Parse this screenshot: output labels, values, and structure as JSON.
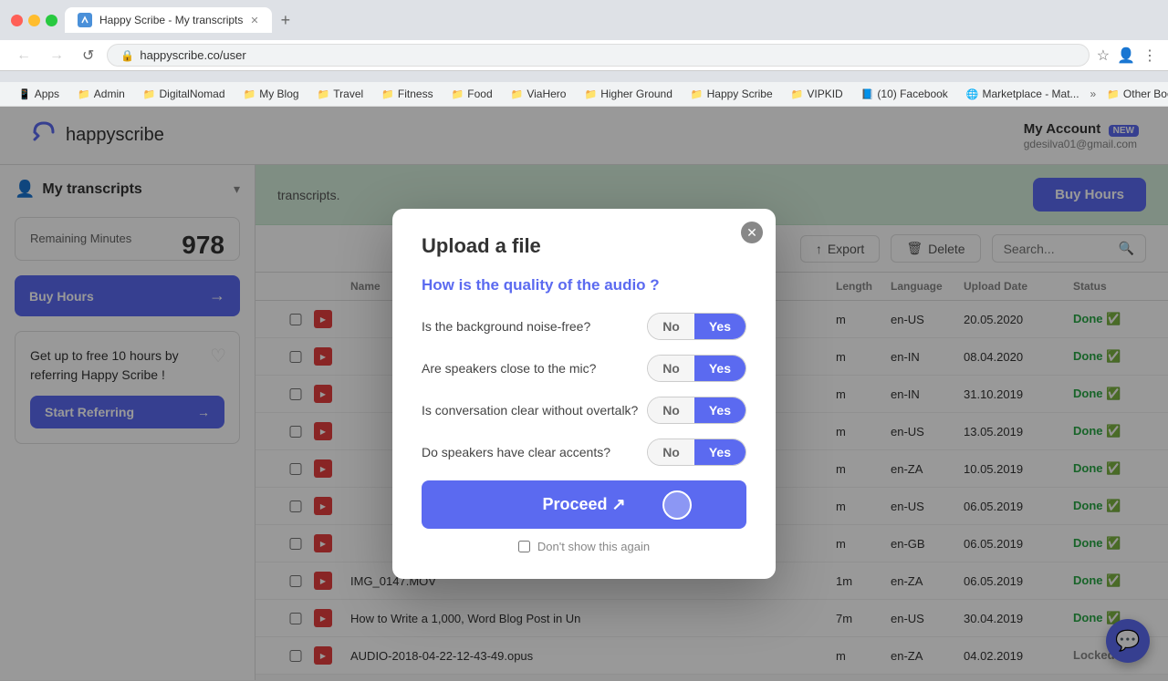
{
  "browser": {
    "tab_label": "Happy Scribe - My transcripts",
    "address": "happyscribe.co/user",
    "back_btn": "←",
    "forward_btn": "→",
    "reload_btn": "↺",
    "bookmarks": [
      {
        "icon": "📱",
        "label": "Apps"
      },
      {
        "icon": "📁",
        "label": "Admin"
      },
      {
        "icon": "📁",
        "label": "DigitalNomad"
      },
      {
        "icon": "📁",
        "label": "My Blog"
      },
      {
        "icon": "📁",
        "label": "Travel"
      },
      {
        "icon": "📁",
        "label": "Fitness"
      },
      {
        "icon": "📁",
        "label": "Food"
      },
      {
        "icon": "📁",
        "label": "ViaHero"
      },
      {
        "icon": "📁",
        "label": "Higher Ground"
      },
      {
        "icon": "📁",
        "label": "Happy Scribe"
      },
      {
        "icon": "📁",
        "label": "VIPKID"
      },
      {
        "icon": "📘",
        "label": "(10) Facebook"
      },
      {
        "icon": "🌐",
        "label": "Marketplace - Mat..."
      },
      {
        "icon": "»",
        "label": "»"
      },
      {
        "icon": "📁",
        "label": "Other Bookmarks"
      }
    ]
  },
  "header": {
    "logo_text": "happyscribe",
    "my_account_label": "My Account",
    "new_badge": "NEW",
    "account_email": "gdesilva01@gmail.com"
  },
  "sidebar": {
    "title": "My transcripts",
    "remaining_label": "Remaining Minutes",
    "remaining_value": "978",
    "buy_hours_btn": "Buy Hours",
    "referral_text": "Get up to free 10 hours by referring Happy Scribe !",
    "start_referring_btn": "Start Referring"
  },
  "content": {
    "banner_text": "transcripts.",
    "buy_hours_btn": "Buy Hours",
    "export_btn": "Export",
    "delete_btn": "Delete",
    "search_placeholder": "Search...",
    "table_headers": [
      "",
      "",
      "Name",
      "Length",
      "Language",
      "Upload Date",
      "Status"
    ],
    "rows": [
      {
        "name": "",
        "length": "m",
        "language": "en-US",
        "date": "20.05.2020",
        "status": "Done"
      },
      {
        "name": "",
        "length": "m",
        "language": "en-IN",
        "date": "08.04.2020",
        "status": "Done"
      },
      {
        "name": "",
        "length": "m",
        "language": "en-IN",
        "date": "31.10.2019",
        "status": "Done"
      },
      {
        "name": "",
        "length": "m",
        "language": "en-US",
        "date": "13.05.2019",
        "status": "Done"
      },
      {
        "name": "",
        "length": "m",
        "language": "en-ZA",
        "date": "10.05.2019",
        "status": "Done"
      },
      {
        "name": "",
        "length": "m",
        "language": "en-US",
        "date": "06.05.2019",
        "status": "Done"
      },
      {
        "name": "",
        "length": "m",
        "language": "en-GB",
        "date": "06.05.2019",
        "status": "Done"
      },
      {
        "name": "IMG_0147.MOV",
        "length": "1m",
        "language": "en-ZA",
        "date": "06.05.2019",
        "status": "Done"
      },
      {
        "name": "How to Write a 1,000, Word Blog Post in Un",
        "length": "7m",
        "language": "en-US",
        "date": "30.04.2019",
        "status": "Done"
      },
      {
        "name": "AUDIO-2018-04-22-12-43-49.opus",
        "length": "m",
        "language": "en-ZA",
        "date": "04.02.2019",
        "status": "Locked"
      }
    ]
  },
  "modal": {
    "title": "Upload a file",
    "question": "How is the quality of the audio ?",
    "questions": [
      {
        "text": "Is the background noise-free?",
        "no_label": "No",
        "yes_label": "Yes",
        "selected": "yes"
      },
      {
        "text": "Are speakers close to the mic?",
        "no_label": "No",
        "yes_label": "Yes",
        "selected": "yes"
      },
      {
        "text": "Is conversation clear without overtalk?",
        "no_label": "No",
        "yes_label": "Yes",
        "selected": "yes"
      },
      {
        "text": "Do speakers have clear accents?",
        "no_label": "No",
        "yes_label": "Yes",
        "selected": "yes"
      }
    ],
    "proceed_btn": "Proceed ↗",
    "dont_show_label": "Don't show this again"
  }
}
